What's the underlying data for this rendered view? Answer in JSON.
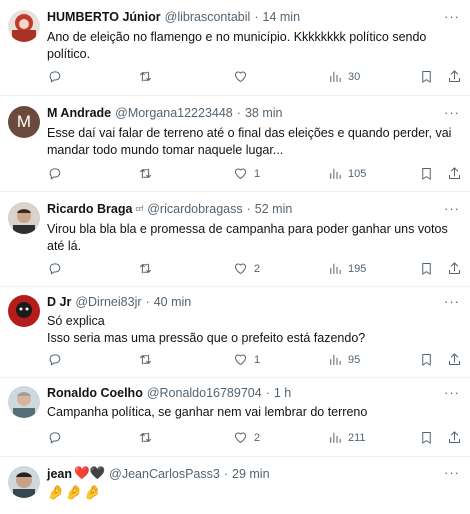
{
  "tweets": [
    {
      "name": "HUMBERTO Júnior",
      "handle": "@librascontabil",
      "separator": "·",
      "time": "14 min",
      "text": "Ano de eleição no flamengo e no município. Kkkkkkkk político sendo político.",
      "reply_count": "",
      "like_count": "",
      "view_count": "30",
      "avatar_color": "#c0392b"
    },
    {
      "name": "M Andrade",
      "handle": "@Morgana12223448",
      "separator": "·",
      "time": "38 min",
      "text": "Esse daí vai falar de terreno até o final das eleições e quando perder, vai mandar todo mundo tomar naquele lugar...",
      "reply_count": "",
      "like_count": "1",
      "view_count": "105",
      "avatar_letter": "M",
      "avatar_color": "#6b4a3c"
    },
    {
      "name": "Ricardo Braga",
      "badge": "crf",
      "handle": "@ricardobragass",
      "separator": "·",
      "time": "52 min",
      "text": "Virou bla bla bla e promessa de campanha para poder ganhar uns votos até lá.",
      "reply_count": "",
      "like_count": "2",
      "view_count": "195",
      "avatar_color": "#8a6a55"
    },
    {
      "name": "D Jr",
      "handle": "@Dirnei83jr",
      "separator": "·",
      "time": "40 min",
      "text": "Só explica\nIsso seria mas uma pressão  que o prefeito  está fazendo?",
      "reply_count": "",
      "like_count": "1",
      "view_count": "95",
      "avatar_color": "#b71c1c"
    },
    {
      "name": "Ronaldo Coelho",
      "handle": "@Ronaldo16789704",
      "separator": "·",
      "time": "1 h",
      "text": "Campanha política, se ganhar nem vai lembrar do terreno",
      "reply_count": "",
      "like_count": "2",
      "view_count": "211",
      "avatar_color": "#7f8c8d"
    },
    {
      "name": "jean",
      "name_suffix": "❤️🖤",
      "handle": "@JeanCarlosPass3",
      "separator": "·",
      "time": "29 min",
      "text": "🤌🤌🤌",
      "avatar_color": "#5d6d7e"
    }
  ],
  "icons": [
    "reply-icon",
    "retweet-icon",
    "like-icon",
    "views-icon",
    "bookmark-icon",
    "share-icon",
    "more-icon"
  ],
  "colors": {
    "text": "#0f1419",
    "muted": "#536471",
    "divider": "#eff3f4"
  }
}
